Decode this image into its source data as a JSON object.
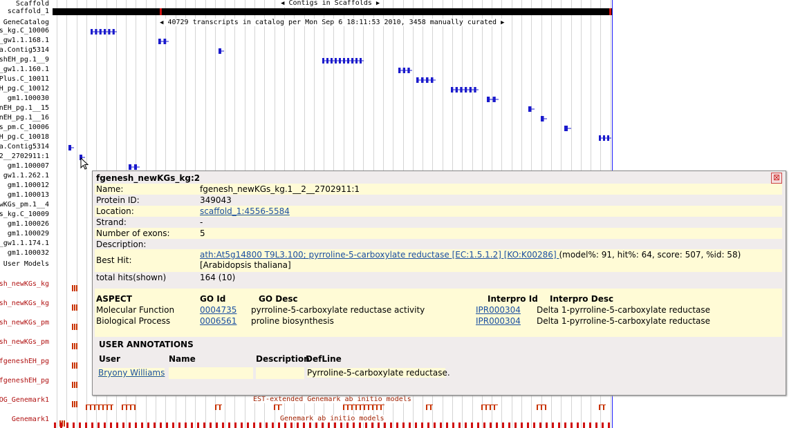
{
  "browser": {
    "track_labels": [
      {
        "text": "Scaffold",
        "color": "black"
      },
      {
        "text": "scaffold_1",
        "color": "black"
      },
      {
        "text": "GeneCatalog",
        "color": "black"
      },
      {
        "text": "s_kg.C_10006",
        "color": "black"
      },
      {
        "text": "_gw1.1.168.1",
        "color": "black"
      },
      {
        "text": "a.Contig5314",
        "color": "black"
      },
      {
        "text": "shEH_pg.1__9",
        "color": "black"
      },
      {
        "text": "_gw1.1.160.1",
        "color": "black"
      },
      {
        "text": "Plus.C_10011",
        "color": "black"
      },
      {
        "text": "H_pg.C_10012",
        "color": "black"
      },
      {
        "text": "gm1.100030",
        "color": "black"
      },
      {
        "text": "nEH_pg.1__15",
        "color": "black"
      },
      {
        "text": "nEH_pg.1__16",
        "color": "black"
      },
      {
        "text": "s_pm.C_10006",
        "color": "black"
      },
      {
        "text": "H_pg.C_10018",
        "color": "black"
      },
      {
        "text": "a.Contig5314",
        "color": "black"
      },
      {
        "text": "2__2702911:1",
        "color": "black"
      },
      {
        "text": "gm1.100007",
        "color": "black"
      },
      {
        "text": "gw1.1.262.1",
        "color": "black"
      },
      {
        "text": "gm1.100012",
        "color": "black"
      },
      {
        "text": "gm1.100013",
        "color": "black"
      },
      {
        "text": "wKGs_pm.1__4",
        "color": "black"
      },
      {
        "text": "s_kg.C_10009",
        "color": "black"
      },
      {
        "text": "gm1.100026",
        "color": "black"
      },
      {
        "text": "gm1.100029",
        "color": "black"
      },
      {
        "text": "_gw1.1.174.1",
        "color": "black"
      },
      {
        "text": "gm1.100032",
        "color": "black"
      },
      {
        "text": "User Models",
        "color": "black"
      },
      {
        "text": "esh_newKGs_kg",
        "color": "red"
      },
      {
        "text": "esh_newKGs_kg",
        "color": "red"
      },
      {
        "text": "esh_newKGs_pm",
        "color": "red"
      },
      {
        "text": "esh_newKGs_pm",
        "color": "red"
      },
      {
        "text": "fgeneshEH_pg",
        "color": "red"
      },
      {
        "text": "fgeneshEH_pg",
        "color": "red"
      },
      {
        "text": "OG_Genemark1",
        "color": "red"
      },
      {
        "text": "Genemark1",
        "color": "red"
      }
    ],
    "contigs_banner": "Contigs in Scaffolds",
    "catalog_banner": "40729 transcripts in catalog per Mon Sep 6 18:11:53 2010, 3458 manually curated",
    "est_banner": "EST-extended Genemark ab initio models",
    "genemark_banner": "Genemark ab initio models",
    "colors": {
      "gene": "#1a1acc",
      "red_track": "#c83200",
      "scaffold": "#000000",
      "redmark": "#d01010"
    }
  },
  "popup": {
    "title": "fgenesh_newKGs_kg:2",
    "close_label": "⊠",
    "fields": [
      {
        "key": "Name:",
        "value": "fgenesh_newKGs_kg.1__2__2702911:1",
        "link": false
      },
      {
        "key": "Protein ID:",
        "value": "349043",
        "link": false
      },
      {
        "key": "Location:",
        "value": "scaffold_1:4556-5584",
        "link": true
      },
      {
        "key": "Strand:",
        "value": "-",
        "link": false
      },
      {
        "key": "Number of exons:",
        "value": "5",
        "link": false
      },
      {
        "key": "Description:",
        "value": "",
        "link": false
      }
    ],
    "best_hit": {
      "key": "Best Hit:",
      "link_text": "ath:At5g14800 T9L3.100; pyrroline-5-carboxylate reductase [EC:1.5.1.2] [KO:K00286] ",
      "rest_text": "(model%: 91, hit%: 64, score: 507, %id: 58) [Arabidopsis thaliana]"
    },
    "total_hits": {
      "key": "total hits(shown)",
      "value": "164 (10)"
    },
    "go_headers": {
      "aspect": "ASPECT",
      "go_id": "GO Id",
      "go_desc": "GO Desc",
      "interpro_id": "Interpro Id",
      "interpro_desc": "Interpro Desc"
    },
    "go_rows": [
      {
        "aspect": "Molecular Function",
        "go_id": "0004735",
        "go_desc": "pyrroline-5-carboxylate reductase activity",
        "interpro_id": "IPR000304",
        "interpro_desc": "Delta 1-pyrroline-5-carboxylate reductase"
      },
      {
        "aspect": "Biological Process",
        "go_id": "0006561",
        "go_desc": "proline biosynthesis",
        "interpro_id": "IPR000304",
        "interpro_desc": "Delta 1-pyrroline-5-carboxylate reductase"
      }
    ],
    "user_annotations": {
      "heading": "USER ANNOTATIONS",
      "headers": {
        "user": "User",
        "name": "Name",
        "description": "Description",
        "defline": "DefLine"
      },
      "row": {
        "user": "Bryony Williams",
        "name": "",
        "description": "",
        "defline": "Pyrroline-5-carboxylate reductase."
      }
    }
  }
}
